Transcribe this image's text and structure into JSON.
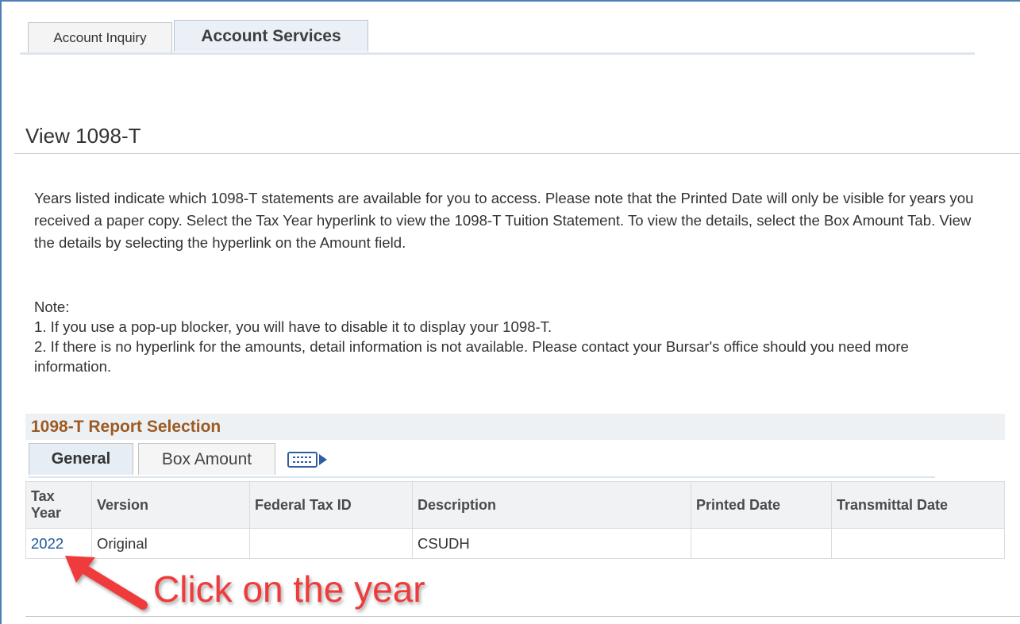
{
  "tabs": [
    {
      "label": "Account Inquiry",
      "active": false
    },
    {
      "label": "Account Services",
      "active": true
    }
  ],
  "page_title": "View 1098-T",
  "instructions": "Years listed indicate which 1098-T statements are available for you to access.  Please note that the Printed Date will only be visible for years you received a paper copy.  Select the Tax Year hyperlink to view the 1098-T Tuition Statement.  To view the details, select the Box Amount Tab.  View the details by selecting the hyperlink on the Amount field.",
  "note": {
    "heading": "Note:",
    "item1": "1.  If you use a pop-up blocker, you will have to disable it to display your 1098-T.",
    "item2": "2.  If there is no hyperlink for the amounts, detail information is not available.  Please contact your Bursar's office should you need more information."
  },
  "section_title": "1098-T Report Selection",
  "grid_tabs": [
    {
      "label": "General",
      "active": true
    },
    {
      "label": "Box Amount",
      "active": false
    }
  ],
  "show_all_icon": "show-all-columns-icon",
  "table": {
    "headers": [
      "Tax Year",
      "Version",
      "Federal Tax ID",
      "Description",
      "Printed Date",
      "Transmittal Date"
    ],
    "rows": [
      {
        "tax_year": "2022",
        "version": "Original",
        "federal_tax_id": "",
        "description": "CSUDH",
        "printed_date": "",
        "transmittal_date": ""
      }
    ]
  },
  "annotation": {
    "text": "Click on the year",
    "color": "#ef3b3b"
  },
  "colors": {
    "link": "#1e5799",
    "section_title": "#9d5a23",
    "frame": "#4f7fb8"
  }
}
